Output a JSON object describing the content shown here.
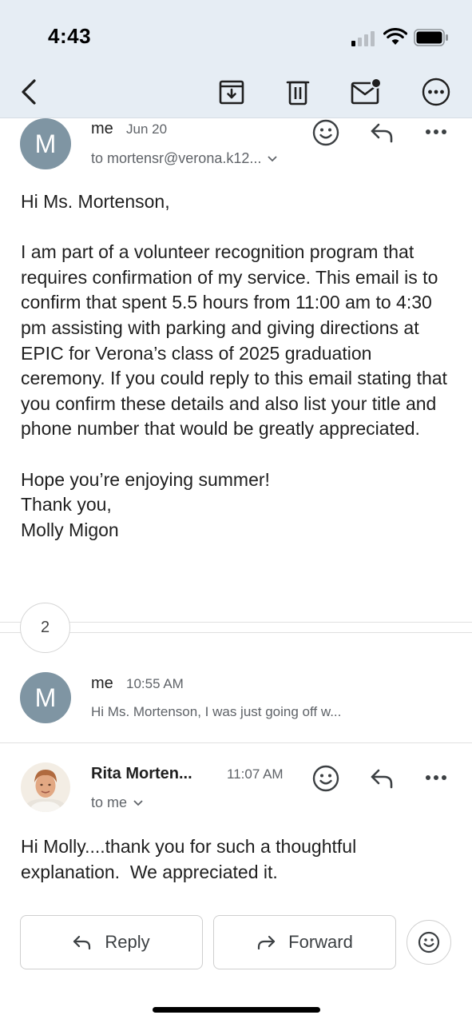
{
  "status_bar": {
    "time": "4:43"
  },
  "toolbar": {
    "icons": [
      "back-icon",
      "archive-icon",
      "trash-icon",
      "mark-unread-icon",
      "more-icon"
    ]
  },
  "message1": {
    "avatar_letter": "M",
    "sender": "me",
    "date": "Jun 20",
    "recipient": "to mortensr@verona.k12...",
    "body": [
      "Hi Ms. Mortenson,",
      "I am part of a volunteer recognition program that requires confirmation of my service. This email is to confirm that spent 5.5 hours from 11:00 am to 4:30 pm assisting with parking and giving directions at EPIC for Verona’s class of 2025 graduation ceremony. If you could reply to this email stating that you confirm these details and also list your title and phone number that would be greatly appreciated.",
      "Hope you’re enjoying summer!\nThank you,\nMolly Migon"
    ]
  },
  "collapsed": {
    "count": "2"
  },
  "message2": {
    "avatar_letter": "M",
    "sender": "me",
    "time": "10:55 AM",
    "snippet": "Hi Ms. Mortenson, I was just going off w..."
  },
  "message3": {
    "sender": "Rita Morten...",
    "time": "11:07 AM",
    "recipient": "to me",
    "body": "Hi Molly....thank you for such a thoughtful explanation.  We appreciated it."
  },
  "actions": {
    "reply_label": "Reply",
    "forward_label": "Forward"
  },
  "colors": {
    "header_bg": "#e6edf4",
    "avatar_bg": "#7f95a3",
    "text": "#1f1f1f",
    "secondary_text": "#5f6368"
  }
}
